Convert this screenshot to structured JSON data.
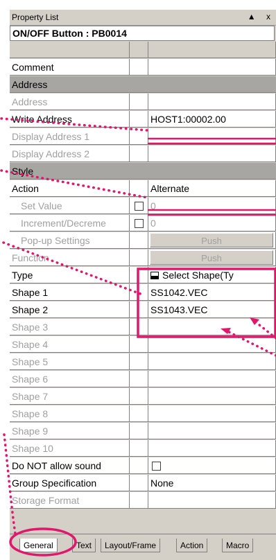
{
  "panel": {
    "title": "Property List",
    "title_controls": "▲ x"
  },
  "header": {
    "object": "ON/OFF Button : PB0014"
  },
  "rows": {
    "comment": {
      "label": "Comment",
      "value": ""
    },
    "address_section": {
      "label": "Address"
    },
    "address": {
      "label": "Address"
    },
    "write_address": {
      "label": "Write Address",
      "value": "HOST1:00002.00"
    },
    "display_address_1": {
      "label": "Display Address 1"
    },
    "display_address_2": {
      "label": "Display Address 2"
    },
    "style_section": {
      "label": "Style"
    },
    "action": {
      "label": "Action",
      "value": "Alternate"
    },
    "set_value": {
      "label": "Set Value",
      "value": "0"
    },
    "increment": {
      "label": "Increment/Decreme",
      "value": "0"
    },
    "popup": {
      "label": "Pop-up Settings",
      "button": "Push"
    },
    "function": {
      "label": "Function",
      "button": "Push"
    },
    "type": {
      "label": "Type",
      "value": "Select Shape(Ty"
    },
    "shape1": {
      "label": "Shape 1",
      "value": "SS1042.VEC"
    },
    "shape2": {
      "label": "Shape 2",
      "value": "SS1043.VEC"
    },
    "shape3": {
      "label": "Shape 3"
    },
    "shape4": {
      "label": "Shape 4"
    },
    "shape5": {
      "label": "Shape 5"
    },
    "shape6": {
      "label": "Shape 6"
    },
    "shape7": {
      "label": "Shape 7"
    },
    "shape8": {
      "label": "Shape 8"
    },
    "shape9": {
      "label": "Shape 9"
    },
    "shape10": {
      "label": "Shape 10"
    },
    "no_sound": {
      "label": "Do NOT allow sound"
    },
    "group_spec": {
      "label": "Group Specification",
      "value": "None"
    },
    "storage": {
      "label": "Storage Format"
    }
  },
  "tabs": [
    "General",
    "Text",
    "Layout/Frame",
    "Action",
    "Macro"
  ],
  "colors": {
    "annotation": "#e0186c",
    "panel": "#d4d0c8",
    "section": "#a7a6a2"
  }
}
